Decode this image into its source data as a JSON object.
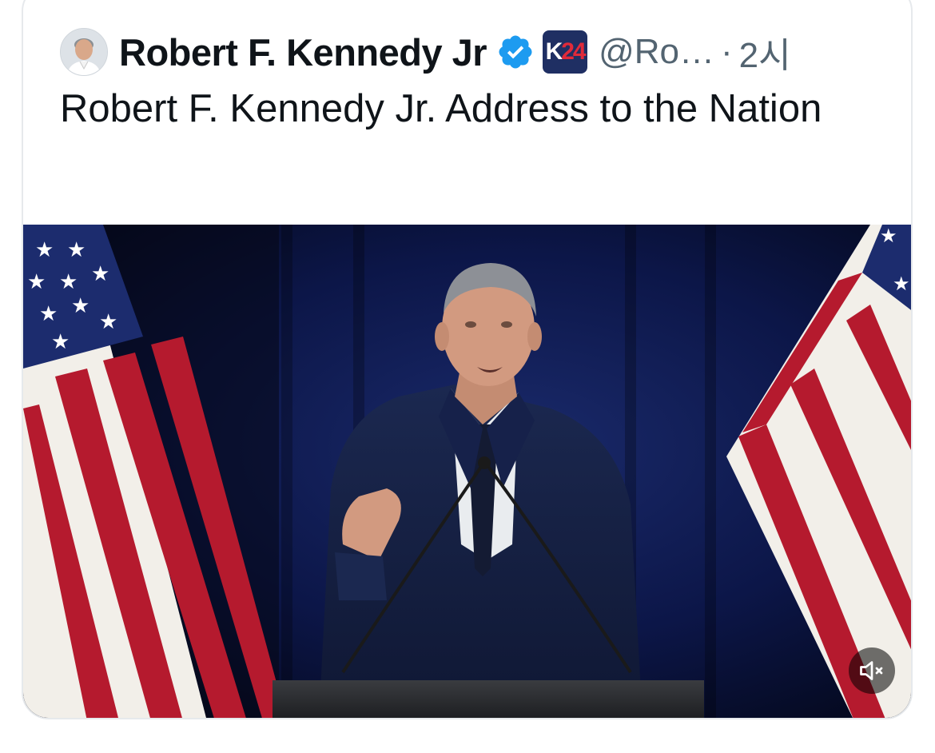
{
  "tweet": {
    "author": {
      "display_name": "Robert F. Kennedy Jr",
      "handle": "@Ro…",
      "verified_icon": "verified-badge-icon",
      "affiliate_badge_text": {
        "k": "K",
        "num": "24"
      }
    },
    "separator": "·",
    "timestamp": "2시",
    "text": "Robert F. Kennedy Jr. Address to the Nation",
    "media": {
      "type": "video",
      "mute_icon": "speaker-muted-icon"
    }
  },
  "colors": {
    "text_primary": "#0f1419",
    "text_secondary": "#536471",
    "verified_blue": "#1d9bf0",
    "affiliate_bg": "#1f2f63",
    "affiliate_red": "#e02a3a"
  }
}
